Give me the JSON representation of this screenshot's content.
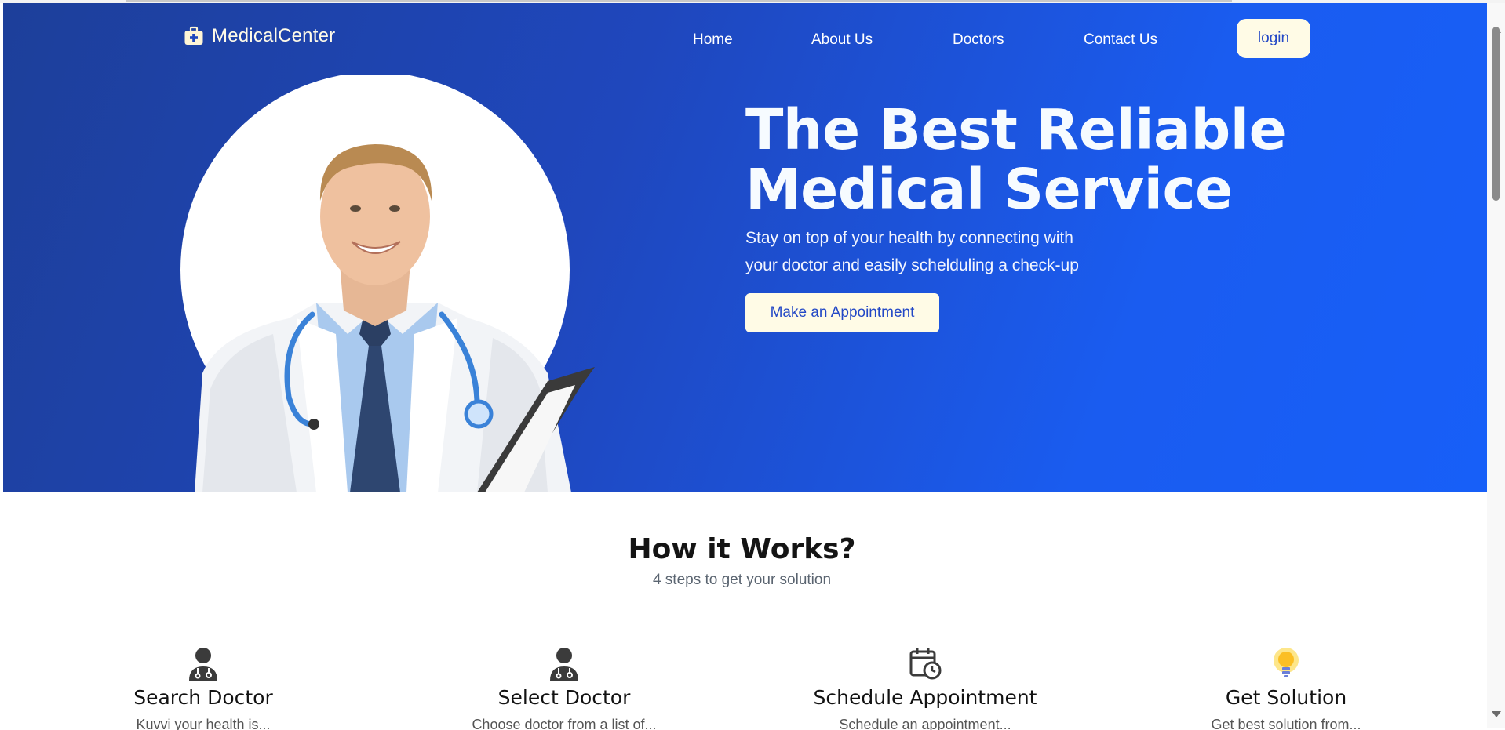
{
  "brand": {
    "name": "MedicalCenter",
    "icon": "medical-kit-icon"
  },
  "nav": {
    "items": [
      {
        "label": "Home"
      },
      {
        "label": "About Us"
      },
      {
        "label": "Doctors"
      },
      {
        "label": "Contact Us"
      }
    ],
    "login_label": "login"
  },
  "hero": {
    "title_line1": "The Best Reliable",
    "title_line2": "Medical Service",
    "subtitle_line1": "Stay on top of your health by connecting with",
    "subtitle_line2": "your doctor and easily schelduling a check-up",
    "cta_label": "Make an Appointment"
  },
  "how": {
    "title": "How it Works?",
    "subtitle": "4 steps to get your solution",
    "steps": [
      {
        "title": "Search Doctor",
        "icon": "doctor-icon",
        "desc": "Kuvvi your health is..."
      },
      {
        "title": "Select Doctor",
        "icon": "doctor-icon",
        "desc": "Choose doctor from a list of..."
      },
      {
        "title": "Schedule Appointment",
        "icon": "calendar-clock-icon",
        "desc": "Schedule an appointment..."
      },
      {
        "title": "Get Solution",
        "icon": "lightbulb-icon",
        "desc": "Get best solution from..."
      }
    ]
  },
  "colors": {
    "hero_start": "#1d3f9a",
    "hero_end": "#175ff8",
    "cream_button": "#fffbe6",
    "button_text": "#2348c6"
  }
}
